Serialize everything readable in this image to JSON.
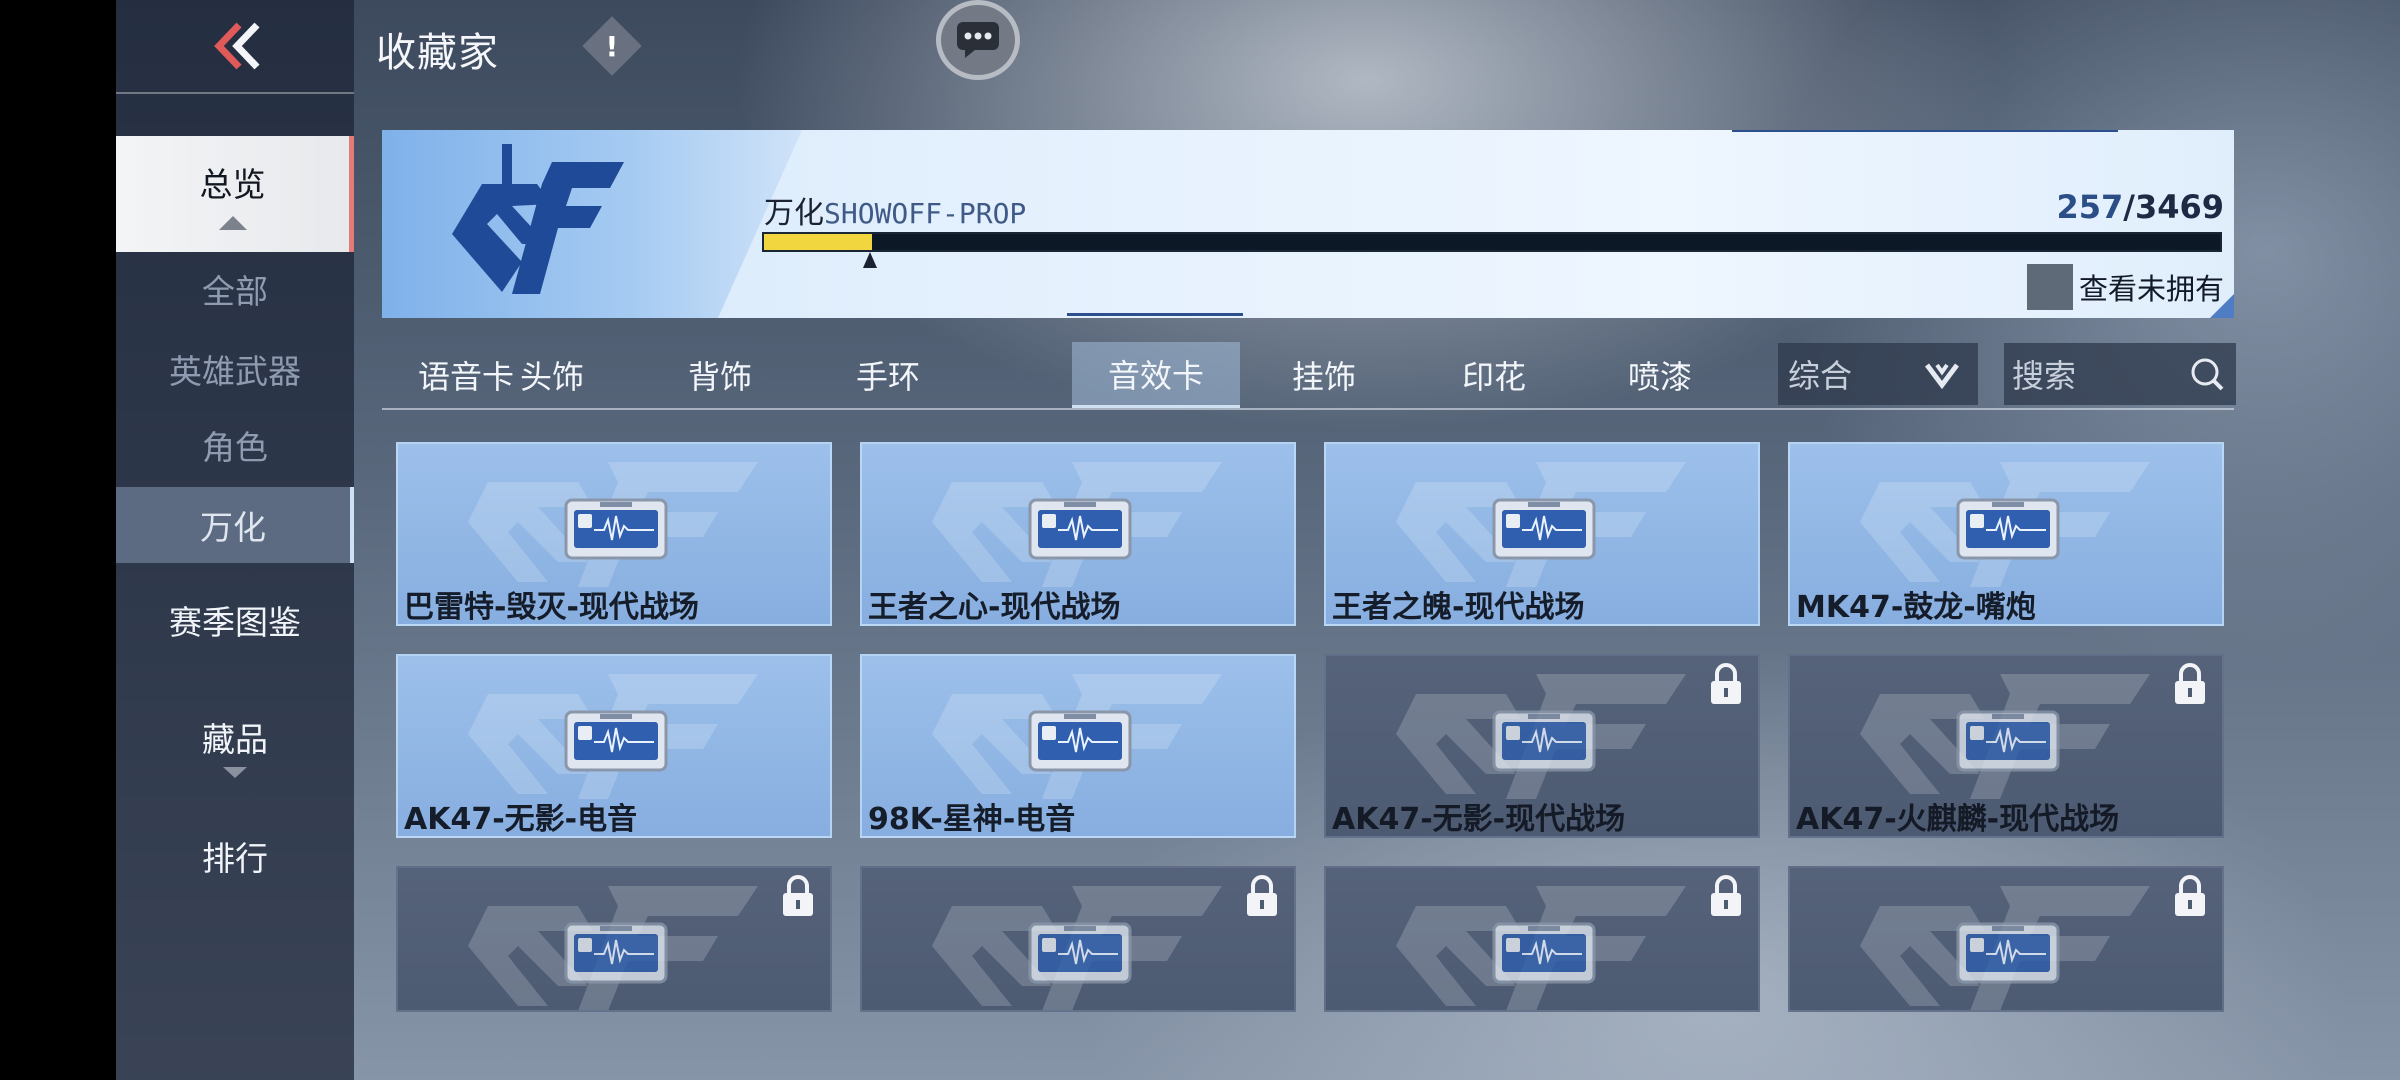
{
  "header": {
    "title": "收藏家",
    "info_icon": "!"
  },
  "sidebar": {
    "overview": "总览",
    "sub_items": [
      "全部",
      "英雄武器",
      "角色",
      "万化"
    ],
    "active_sub": 3,
    "main_items": [
      "赛季图鉴",
      "藏品",
      "排行"
    ]
  },
  "banner": {
    "category": "万化",
    "category_en": "SHOWOFF-PROP",
    "owned": "257",
    "total": "/3469",
    "progress_fraction": 0.074,
    "show_unowned_label": "查看未拥有"
  },
  "tabs": [
    "语音卡",
    "头饰",
    "背饰",
    "手环",
    "音效卡",
    "挂饰",
    "印花",
    "喷漆"
  ],
  "active_tab": 4,
  "sort": {
    "value": "综合"
  },
  "search": {
    "placeholder": "搜索"
  },
  "items": [
    {
      "name": "巴雷特-毁灭-现代战场",
      "locked": false
    },
    {
      "name": "王者之心-现代战场",
      "locked": false
    },
    {
      "name": "王者之魄-现代战场",
      "locked": false
    },
    {
      "name": "MK47-鼓龙-嘴炮",
      "locked": false
    },
    {
      "name": "AK47-无影-电音",
      "locked": false
    },
    {
      "name": "98K-星神-电音",
      "locked": false
    },
    {
      "name": "AK47-无影-现代战场",
      "locked": true
    },
    {
      "name": "AK47-火麒麟-现代战场",
      "locked": true
    },
    {
      "name": "",
      "locked": true
    },
    {
      "name": "",
      "locked": true
    },
    {
      "name": "",
      "locked": true
    },
    {
      "name": "",
      "locked": true
    }
  ],
  "colors": {
    "accent_yellow": "#f2d640",
    "owned_card": "#9cc0ea",
    "locked_card": "#55627a",
    "active_marker": "#e57a7a"
  }
}
